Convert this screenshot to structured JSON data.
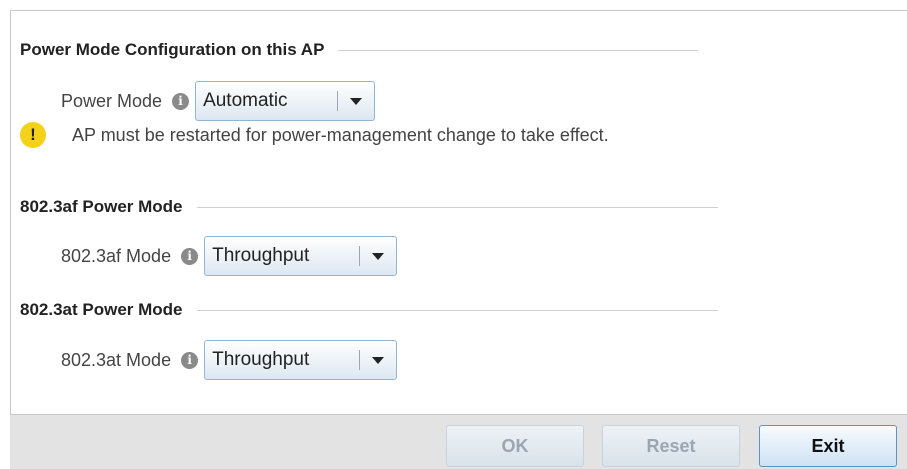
{
  "sections": {
    "power_mode_config": {
      "title": "Power Mode Configuration on this AP",
      "field_label": "Power Mode",
      "selected": "Automatic"
    },
    "warning": {
      "icon": "warning-icon",
      "text": "AP must be restarted for power-management change to take effect."
    },
    "af_power_mode": {
      "title": "802.3af Power Mode",
      "field_label": "802.3af Mode",
      "selected": "Throughput"
    },
    "at_power_mode": {
      "title": "802.3at Power Mode",
      "field_label": "802.3at Mode",
      "selected": "Throughput"
    }
  },
  "footer": {
    "ok_label": "OK",
    "reset_label": "Reset",
    "exit_label": "Exit"
  },
  "colors": {
    "accent_border": "#5d93c4",
    "warning": "#f4d21a",
    "info_icon": "#8a8a8a"
  },
  "icons": {
    "info": "info-icon",
    "dropdown": "chevron-down-icon",
    "warning": "warning-icon"
  }
}
